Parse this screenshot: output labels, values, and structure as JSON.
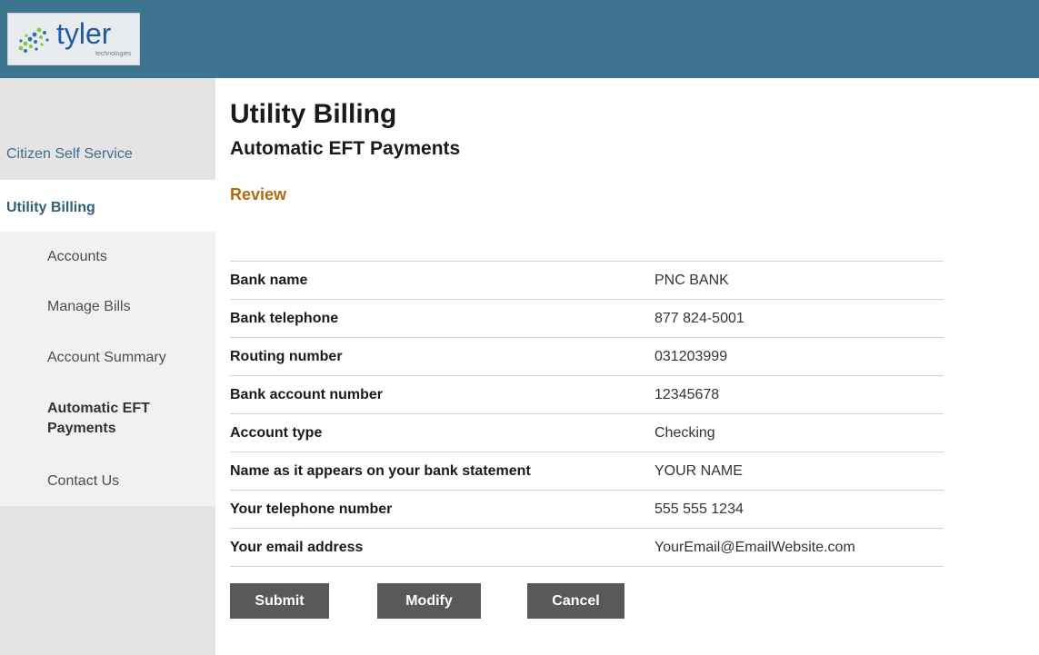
{
  "header": {
    "logo_text": "tyler",
    "logo_subtext": "technologies"
  },
  "sidebar": {
    "root_link": "Citizen Self Service",
    "section": "Utility Billing",
    "items": [
      {
        "label": "Accounts"
      },
      {
        "label": "Manage Bills"
      },
      {
        "label": "Account Summary"
      },
      {
        "label": "Automatic EFT Payments",
        "active": true
      },
      {
        "label": "Contact Us"
      }
    ]
  },
  "main": {
    "title": "Utility Billing",
    "subtitle": "Automatic EFT Payments",
    "step": "Review",
    "step_color": "#b06b12",
    "rows": [
      {
        "label": "Bank name",
        "value": "PNC BANK"
      },
      {
        "label": "Bank telephone",
        "value": "877 824-5001"
      },
      {
        "label": "Routing number",
        "value": "031203999"
      },
      {
        "label": "Bank account number",
        "value": "12345678"
      },
      {
        "label": "Account type",
        "value": "Checking"
      },
      {
        "label": "Name as it appears on your bank statement",
        "value": "YOUR NAME"
      },
      {
        "label": "Your telephone number",
        "value": "555 555 1234"
      },
      {
        "label": "Your email address",
        "value": "YourEmail@EmailWebsite.com"
      }
    ],
    "buttons": {
      "submit": "Submit",
      "modify": "Modify",
      "cancel": "Cancel"
    }
  },
  "colors": {
    "header_bg": "#3d7591",
    "link": "#3b6f8a",
    "button_bg": "#595959"
  }
}
